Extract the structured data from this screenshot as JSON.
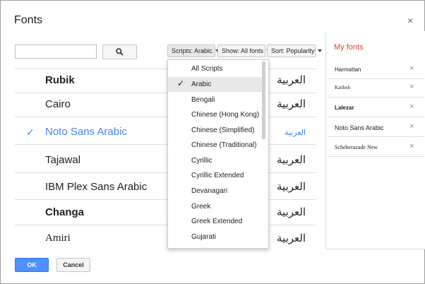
{
  "dialog": {
    "title": "Fonts",
    "close_glyph": "×"
  },
  "search": {
    "value": "",
    "placeholder": ""
  },
  "filters": {
    "scripts_label": "Scripts: Arabic",
    "show_label": "Show: All fonts",
    "sort_label": "Sort: Popularity"
  },
  "font_list": [
    {
      "name": "Rubik",
      "sample": "العربية",
      "selected": false
    },
    {
      "name": "Cairo",
      "sample": "العربية",
      "selected": false
    },
    {
      "name": "Noto Sans Arabic",
      "sample": "العربية",
      "selected": true,
      "check": "✓"
    },
    {
      "name": "Tajawal",
      "sample": "العربية",
      "selected": false
    },
    {
      "name": "IBM Plex Sans Arabic",
      "sample": "العربية",
      "selected": false
    },
    {
      "name": "Changa",
      "sample": "العربية",
      "selected": false
    },
    {
      "name": "Amiri",
      "sample": "العربية",
      "selected": false
    }
  ],
  "scripts_dropdown": {
    "options": [
      "All Scripts",
      "Arabic",
      "Bengali",
      "Chinese (Hong Kong)",
      "Chinese (Simplified)",
      "Chinese (Traditional)",
      "Cyrillic",
      "Cyrillic Extended",
      "Devanagari",
      "Greek",
      "Greek Extended",
      "Gujarati"
    ],
    "selected": "Arabic",
    "check": "✓"
  },
  "my_fonts": {
    "title": "My fonts",
    "items": [
      {
        "name": "Harmattan",
        "remove": "×"
      },
      {
        "name": "Katibeh",
        "remove": "×"
      },
      {
        "name": "Lalezar",
        "remove": "×"
      },
      {
        "name": "Noto Sans Arabic",
        "remove": "×"
      },
      {
        "name": "Scheherazade New",
        "remove": "×"
      }
    ]
  },
  "buttons": {
    "ok_label": "OK",
    "cancel_label": "Cancel"
  },
  "colors": {
    "accent": "#4285f4",
    "my_fonts_title": "#db4437",
    "ok_button": "#4d90fe"
  },
  "icons": {
    "search_button": "search-icon",
    "close": "close-icon",
    "dropdown_caret": "caret-down-icon"
  }
}
